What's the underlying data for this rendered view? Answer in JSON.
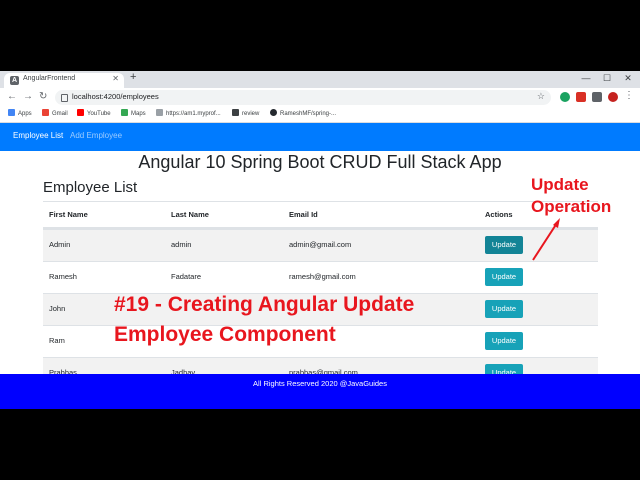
{
  "browser": {
    "tab_title": "AngularFrontend",
    "url": "localhost:4200/employees",
    "bookmarks": [
      "Apps",
      "Gmail",
      "YouTube",
      "Maps",
      "https://am1.myprof...",
      "review",
      "RameshMF/spring-..."
    ]
  },
  "navbar": {
    "brand": "Employee List",
    "link": "Add Employee",
    "color": "#007bff"
  },
  "page": {
    "title": "Angular 10 Spring Boot CRUD Full Stack App",
    "section_title": "Employee List"
  },
  "table": {
    "headers": [
      "First Name",
      "Last Name",
      "Email Id",
      "Actions"
    ],
    "rows": [
      {
        "first": "Admin",
        "last": "admin",
        "email": "admin@gmail.com",
        "action": "Update"
      },
      {
        "first": "Ramesh",
        "last": "Fadatare",
        "email": "ramesh@gmail.com",
        "action": "Update"
      },
      {
        "first": "John",
        "last": "",
        "email": "",
        "action": "Update"
      },
      {
        "first": "Ram",
        "last": "",
        "email": "",
        "action": "Update"
      },
      {
        "first": "Prabhas",
        "last": "Jadhav",
        "email": "prabhas@gmail.com",
        "action": "Update"
      }
    ]
  },
  "footer": {
    "text": "All Rights Reserved 2020 @JavaGuides",
    "color": "#0000ff"
  },
  "overlay": {
    "line1": "#19 - Creating Angular Update",
    "line2": "Employee Component",
    "callout_line1": "Update",
    "callout_line2": "Operation",
    "color": "#e8161e"
  }
}
